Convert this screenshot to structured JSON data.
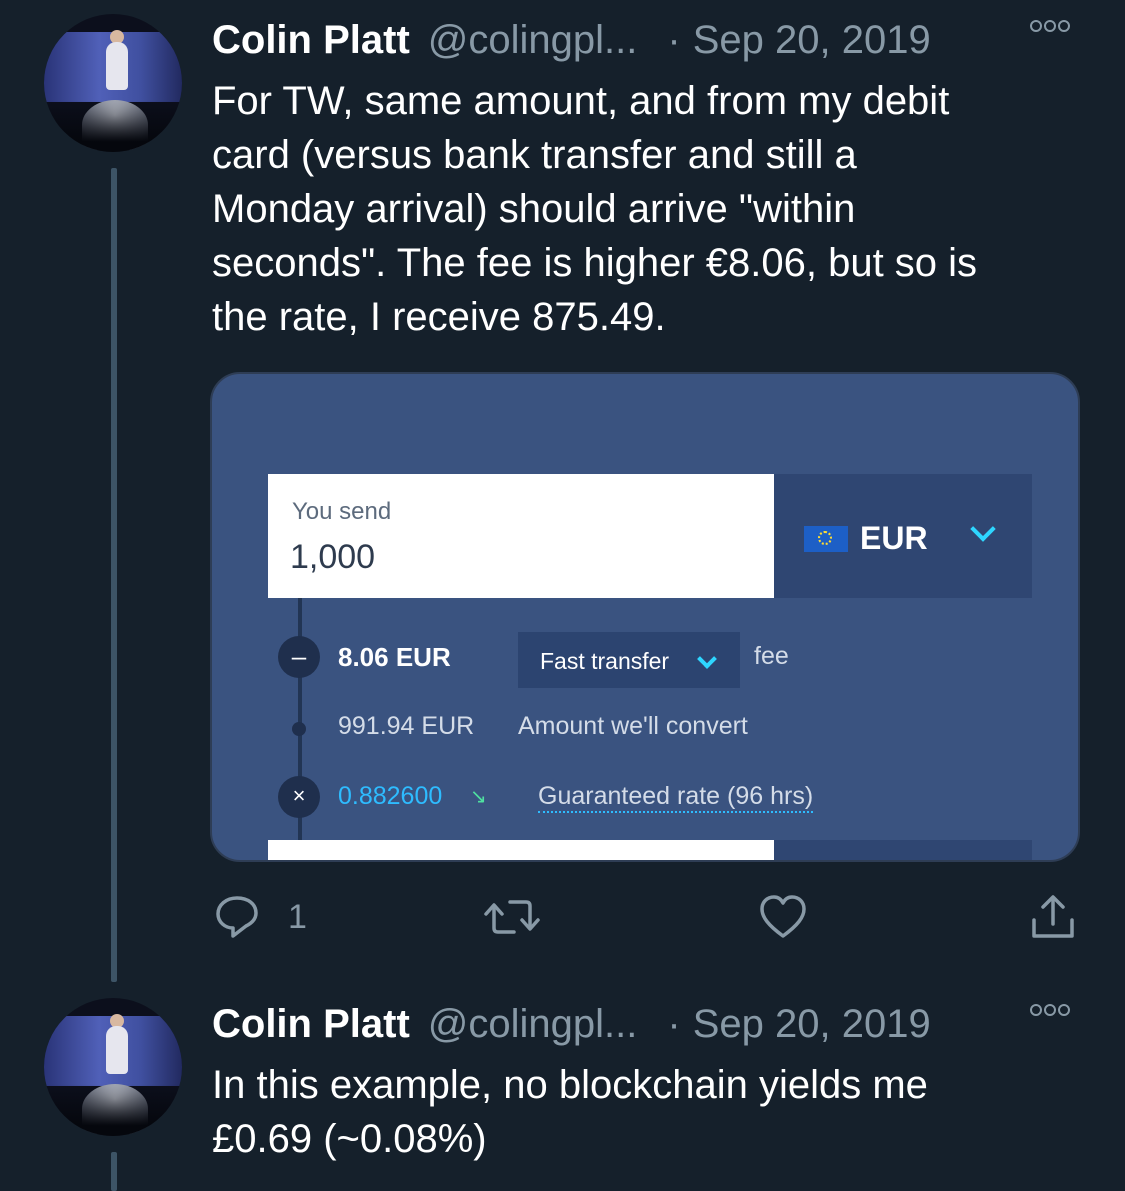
{
  "tweets": [
    {
      "name": "Colin Platt",
      "handle": "@colingpl...",
      "separator": "·",
      "date": "Sep 20, 2019",
      "text_lines": [
        "For TW, same amount, and from my debit",
        "card (versus bank transfer and still a",
        "Monday arrival) should arrive \"within",
        "seconds\". The fee is higher €8.06, but so is",
        "the rate, I receive 875.49."
      ],
      "actions": {
        "reply_count": "1"
      }
    },
    {
      "name": "Colin Platt",
      "handle": "@colingpl...",
      "separator": "·",
      "date": "Sep 20, 2019",
      "text_lines": [
        "In this example, no blockchain yields me",
        "£0.69 (~0.08%)"
      ]
    }
  ],
  "media": {
    "send_label": "You send",
    "send_value": "1,000",
    "currency": "EUR",
    "fee_amount": "8.06 EUR",
    "fee_type": "Fast transfer",
    "fee_label": "fee",
    "convert_amount": "991.94 EUR",
    "convert_label": "Amount we'll convert",
    "rate_value": "0.882600",
    "rate_label": "Guaranteed rate (96 hrs)",
    "minus_symbol": "–",
    "times_symbol": "×",
    "trend_symbol": "↘"
  },
  "icons": [
    "reply-icon",
    "retweet-icon",
    "like-icon",
    "share-icon",
    "more-icon",
    "eu-flag-icon",
    "chevron-down-icon"
  ],
  "colors": {
    "background": "#15202b",
    "secondary_text": "#8899a6",
    "thread_line": "#3d5466",
    "accent_blue": "#2ebcff"
  }
}
